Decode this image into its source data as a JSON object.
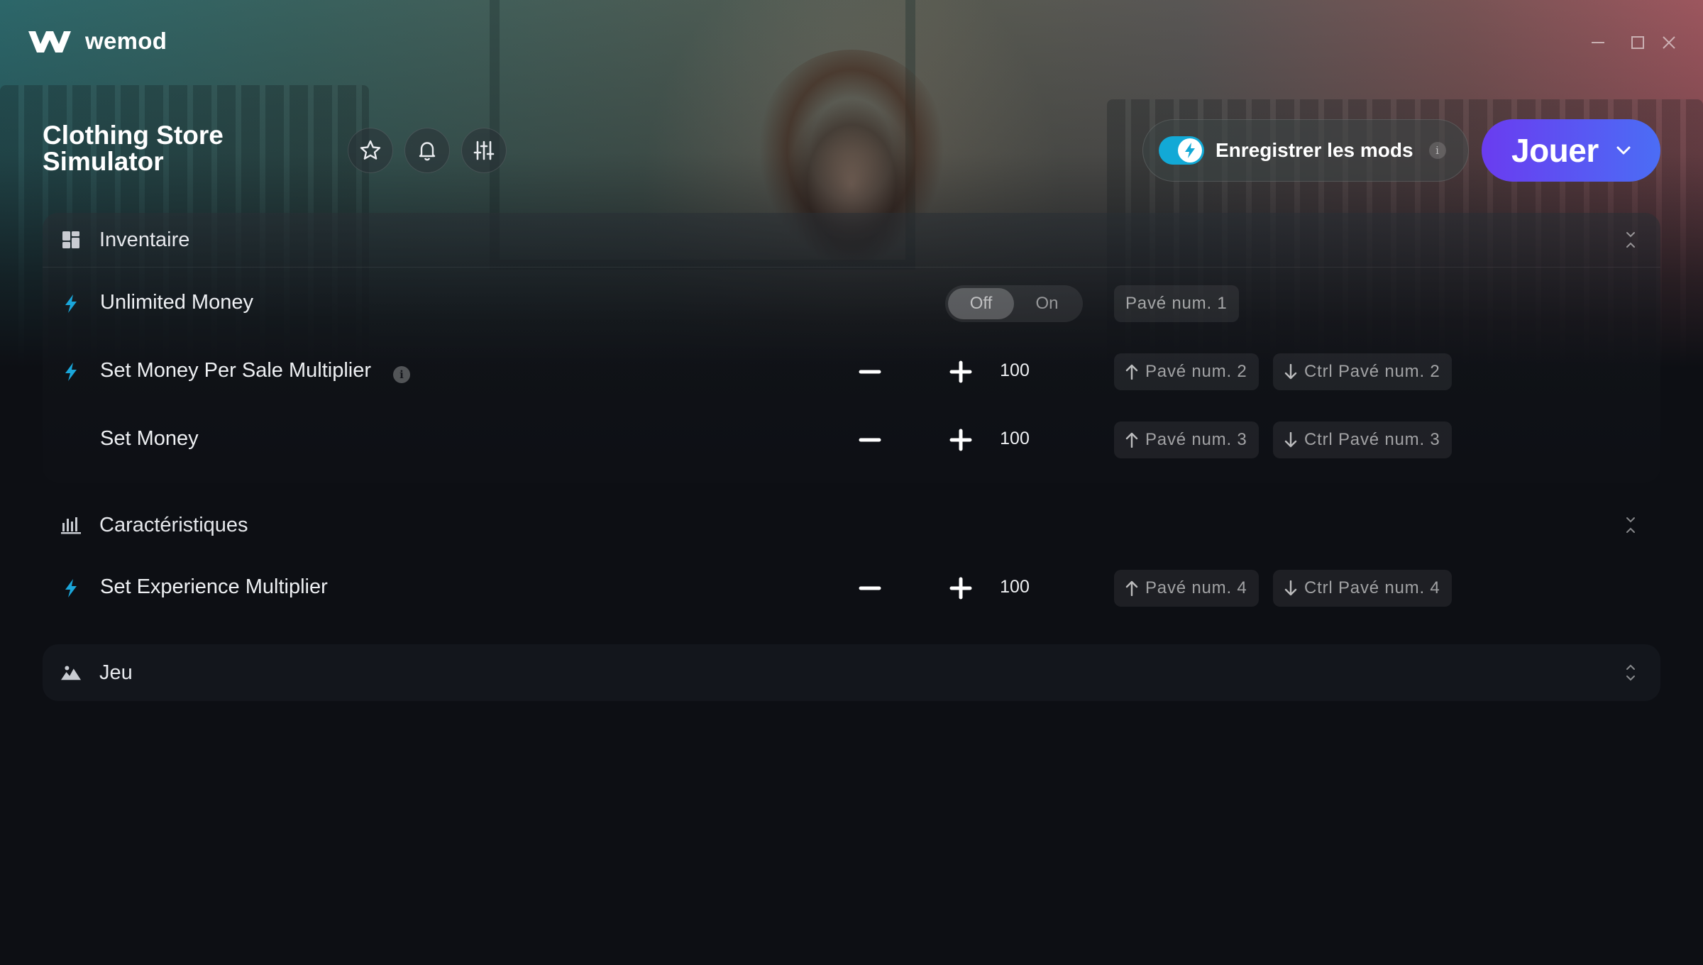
{
  "app": {
    "brand": "wemod",
    "window_controls": [
      "minimize-icon",
      "maximize-icon",
      "close-icon"
    ]
  },
  "game": {
    "title_line1": "Clothing Store",
    "title_line2": "Simulator",
    "actions": [
      "star-icon",
      "bell-icon",
      "sliders-icon"
    ]
  },
  "record": {
    "label": "Enregistrer les mods",
    "enabled": true,
    "info": "i"
  },
  "play": {
    "label": "Jouer"
  },
  "sections": {
    "inventaire": {
      "title": "Inventaire",
      "icon": "grid-icon",
      "rows": {
        "unlimited_money": {
          "name": "Unlimited Money",
          "off_label": "Off",
          "on_label": "On",
          "state": "Off",
          "hotkey": "Pavé num. 1"
        },
        "money_per_sale": {
          "name": "Set Money Per Sale Multiplier",
          "info": "i",
          "value": "100",
          "hotkey_up": "Pavé num. 2",
          "hotkey_down": "Ctrl Pavé num. 2"
        },
        "set_money": {
          "name": "Set Money",
          "value": "100",
          "hotkey_up": "Pavé num. 3",
          "hotkey_down": "Ctrl Pavé num. 3"
        }
      }
    },
    "caracteristiques": {
      "title": "Caractéristiques",
      "icon": "bar-chart-icon",
      "rows": {
        "experience": {
          "name": "Set Experience Multiplier",
          "value": "100",
          "hotkey_up": "Pavé num. 4",
          "hotkey_down": "Ctrl Pavé num. 4"
        }
      }
    },
    "jeu": {
      "title": "Jeu",
      "icon": "landscape-icon"
    }
  },
  "colors": {
    "accent": "#12a9d6",
    "play_gradient_start": "#6a3cf0",
    "play_gradient_end": "#4b6df5",
    "background": "#0d0f14"
  }
}
